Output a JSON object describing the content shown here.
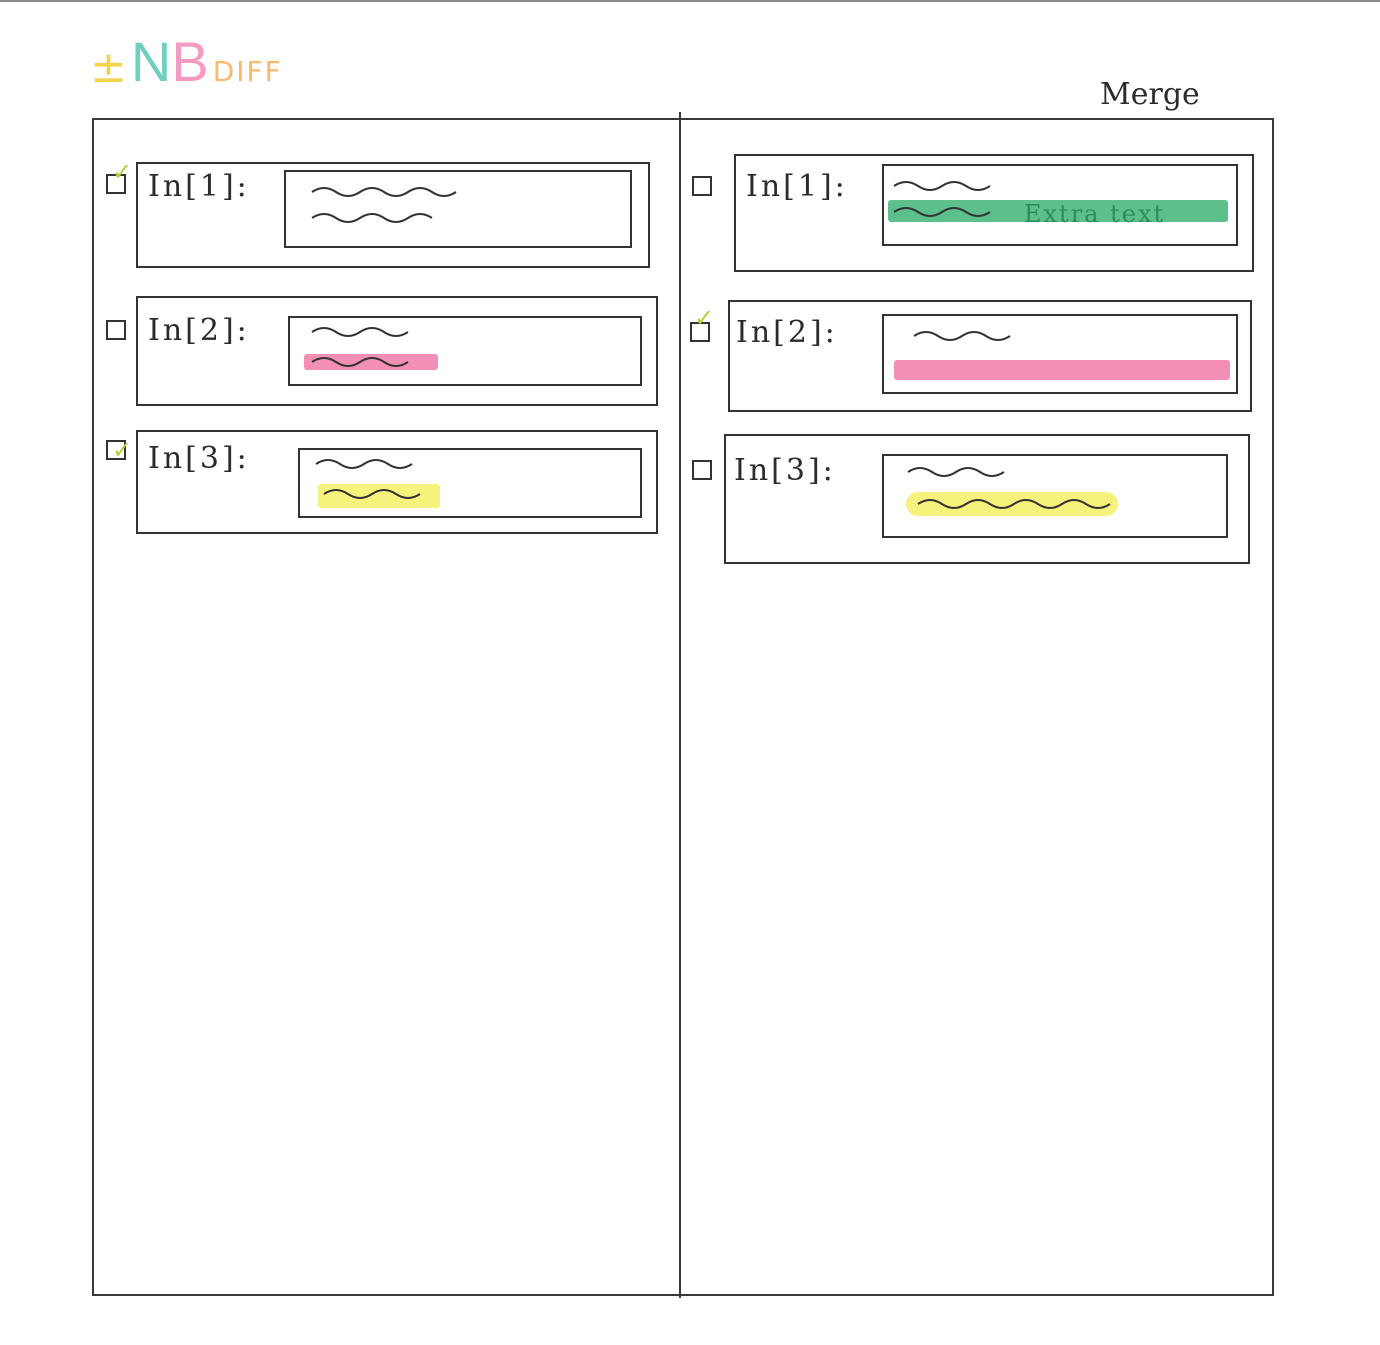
{
  "app": {
    "logo": {
      "plusminus": "±",
      "n": "N",
      "b": "B",
      "diff": "DIFF"
    },
    "merge_label": "Merge"
  },
  "colors": {
    "added": "#5cbf8c",
    "removed": "#f38fb4",
    "modified": "#f6f27c",
    "check": "#b6cf3e",
    "ink": "#2b2b2b"
  },
  "left_panel": {
    "cells": [
      {
        "prompt": "In[1]:",
        "checked": true,
        "highlight": "none"
      },
      {
        "prompt": "In[2]:",
        "checked": false,
        "highlight": "removed"
      },
      {
        "prompt": "In[3]:",
        "checked": true,
        "highlight": "modified"
      }
    ]
  },
  "right_panel": {
    "cells": [
      {
        "prompt": "In[1]:",
        "checked": false,
        "highlight": "added",
        "extra_text": "Extra text"
      },
      {
        "prompt": "In[2]:",
        "checked": true,
        "highlight": "removed"
      },
      {
        "prompt": "In[3]:",
        "checked": false,
        "highlight": "modified"
      }
    ]
  }
}
